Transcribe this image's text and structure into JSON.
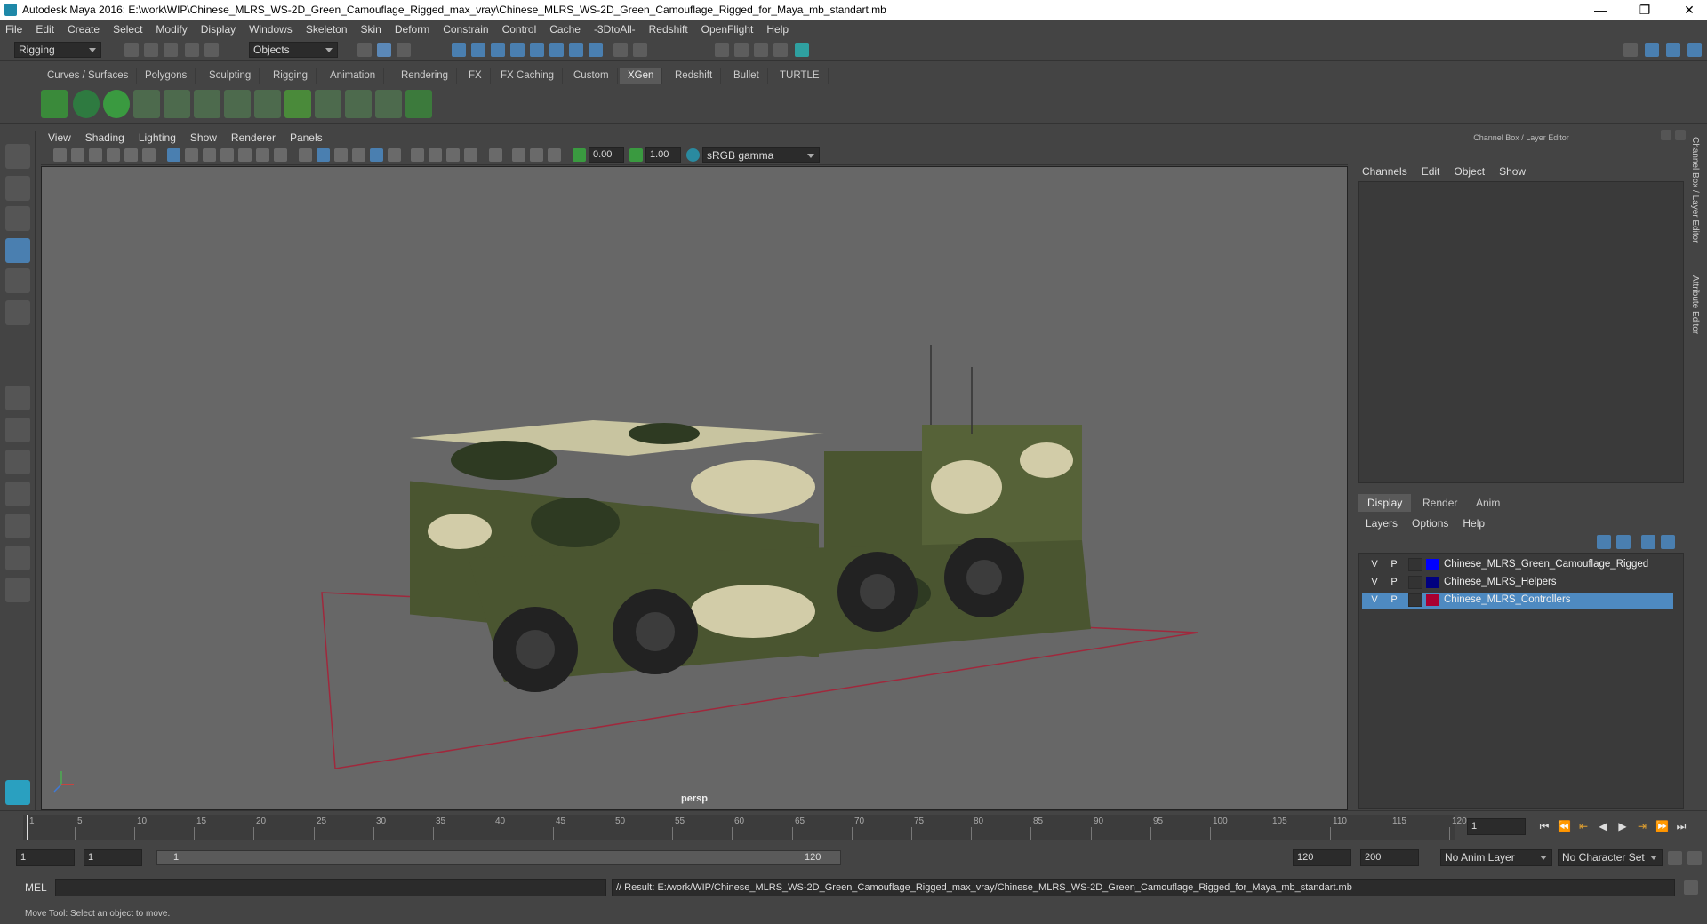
{
  "window": {
    "title": "Autodesk Maya 2016: E:\\work\\WIP\\Chinese_MLRS_WS-2D_Green_Camouflage_Rigged_max_vray\\Chinese_MLRS_WS-2D_Green_Camouflage_Rigged_for_Maya_mb_standart.mb",
    "minimize": "—",
    "restore": "❐",
    "close": "✕"
  },
  "menubar": [
    "File",
    "Edit",
    "Create",
    "Select",
    "Modify",
    "Display",
    "Windows",
    "Skeleton",
    "Skin",
    "Deform",
    "Constrain",
    "Control",
    "Cache",
    "-3DtoAll-",
    "Redshift",
    "OpenFlight",
    "Help"
  ],
  "statusline": {
    "menuset": "Rigging",
    "selmode": "Objects"
  },
  "shelf": {
    "tabs": [
      "Curves / Surfaces",
      "Polygons",
      "Sculpting",
      "Rigging",
      "Animation",
      "Rendering",
      "FX",
      "FX Caching",
      "Custom",
      "XGen",
      "Redshift",
      "Bullet",
      "TURTLE"
    ],
    "active": "XGen"
  },
  "viewport": {
    "menu": [
      "View",
      "Shading",
      "Lighting",
      "Show",
      "Renderer",
      "Panels"
    ],
    "exposure": "0.00",
    "gamma": "1.00",
    "colorspace": "sRGB gamma",
    "camera": "persp"
  },
  "channelbox": {
    "title": "Channel Box / Layer Editor",
    "menu": [
      "Channels",
      "Edit",
      "Object",
      "Show"
    ]
  },
  "layereditor": {
    "tabs": [
      "Display",
      "Render",
      "Anim"
    ],
    "active": "Display",
    "menu": [
      "Layers",
      "Options",
      "Help"
    ],
    "layers": [
      {
        "v": "V",
        "p": "P",
        "name": "Chinese_MLRS_Green_Camouflage_Rigged",
        "color": "#0000ff",
        "selected": false
      },
      {
        "v": "V",
        "p": "P",
        "name": "Chinese_MLRS_Helpers",
        "color": "#000080",
        "selected": false
      },
      {
        "v": "V",
        "p": "P",
        "name": "Chinese_MLRS_Controllers",
        "color": "#aa0030",
        "selected": true
      }
    ]
  },
  "sidetabs": [
    "Channel Box / Layer Editor",
    "Attribute Editor"
  ],
  "timeslider": {
    "labels": [
      "1",
      "5",
      "10",
      "15",
      "20",
      "25",
      "30",
      "35",
      "40",
      "45",
      "50",
      "55",
      "60",
      "65",
      "70",
      "75",
      "80",
      "85",
      "90",
      "95",
      "100",
      "105",
      "110",
      "115",
      "120"
    ],
    "current": "1"
  },
  "rangeslider": {
    "start": "1",
    "playstart": "1",
    "rangestart": "1",
    "rangeend": "120",
    "playend": "120",
    "end": "200",
    "animlayer": "No Anim Layer",
    "charset": "No Character Set"
  },
  "cmdline": {
    "lang": "MEL",
    "result": "// Result: E:/work/WIP/Chinese_MLRS_WS-2D_Green_Camouflage_Rigged_max_vray/Chinese_MLRS_WS-2D_Green_Camouflage_Rigged_for_Maya_mb_standart.mb"
  },
  "helpline": "Move Tool: Select an object to move."
}
